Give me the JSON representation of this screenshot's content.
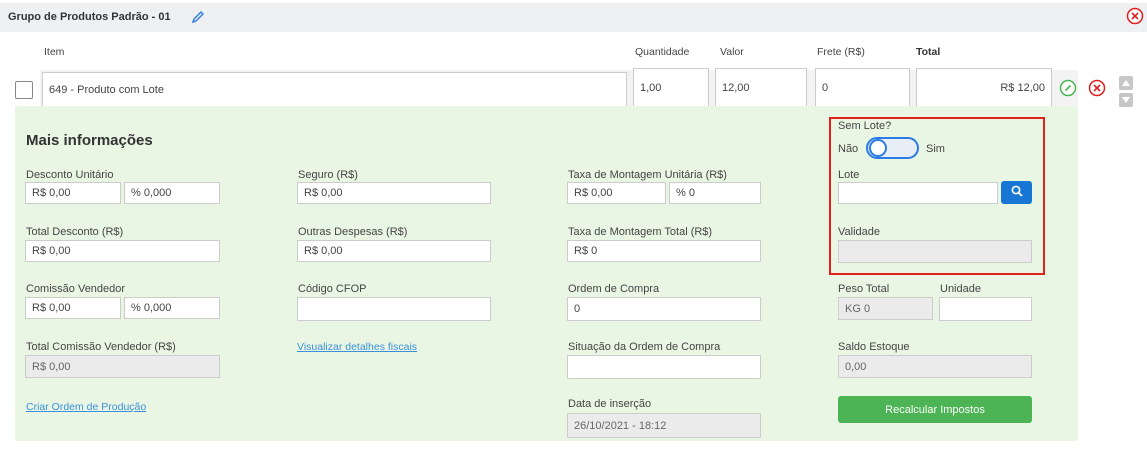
{
  "header": {
    "title": "Grupo de Produtos Padrão - 01"
  },
  "columns": {
    "item": "Item",
    "quantidade": "Quantidade",
    "valor": "Valor",
    "frete": "Frete (R$)",
    "total": "Total"
  },
  "item_row": {
    "item": "649 - Produto com Lote",
    "quantidade": "1,00",
    "valor": "12,00",
    "frete": "0",
    "total": "R$ 12,00"
  },
  "details": {
    "title": "Mais informações",
    "desconto_unitario": {
      "label": "Desconto Unitário",
      "value": "R$ 0,00",
      "percent": "% 0,000"
    },
    "total_desconto": {
      "label": "Total Desconto (R$)",
      "value": "R$ 0,00"
    },
    "comissao_vendedor": {
      "label": "Comissão Vendedor",
      "value": "R$ 0,00",
      "percent": "% 0,000"
    },
    "total_comissao": {
      "label": "Total Comissão Vendedor (R$)",
      "value": "R$ 0,00"
    },
    "criar_ordem_link": "Criar Ordem de Produção",
    "seguro": {
      "label": "Seguro (R$)",
      "value": "R$ 0,00"
    },
    "outras_despesas": {
      "label": "Outras Despesas (R$)",
      "value": "R$ 0,00"
    },
    "codigo_cfop": {
      "label": "Código CFOP",
      "value": ""
    },
    "fiscal_link": "Visualizar detalhes fiscais",
    "taxa_montagem_unitaria": {
      "label": "Taxa de Montagem Unitária (R$)",
      "value": "R$ 0,00",
      "percent": "% 0"
    },
    "taxa_montagem_total": {
      "label": "Taxa de Montagem Total (R$)",
      "value": "R$ 0"
    },
    "ordem_compra": {
      "label": "Ordem de Compra",
      "value": "0"
    },
    "situacao_ordem": {
      "label": "Situação da Ordem de Compra",
      "value": ""
    },
    "data_insercao": {
      "label": "Data de inserção",
      "value": "26/10/2021 - 18:12"
    },
    "sem_lote": {
      "label": "Sem Lote?",
      "off_label": "Não",
      "on_label": "Sim",
      "enabled": false
    },
    "lote": {
      "label": "Lote",
      "value": ""
    },
    "validade": {
      "label": "Validade",
      "value": ""
    },
    "peso_total": {
      "label": "Peso Total",
      "value": "KG 0"
    },
    "unidade": {
      "label": "Unidade",
      "value": ""
    },
    "saldo_estoque": {
      "label": "Saldo Estoque",
      "value": "0,00"
    },
    "recalc_button": "Recalcular Impostos"
  },
  "colors": {
    "header_bg": "#eef0f2",
    "panel_bg": "#eaf6e4",
    "accent_blue": "#1876d4",
    "button_green": "#4cb454",
    "close_red": "#e12020",
    "highlight_red": "#e12020"
  },
  "icons": [
    "pencil-icon",
    "close-circle-icon",
    "check-circle-icon",
    "search-icon",
    "arrow-up-icon",
    "arrow-down-icon"
  ]
}
